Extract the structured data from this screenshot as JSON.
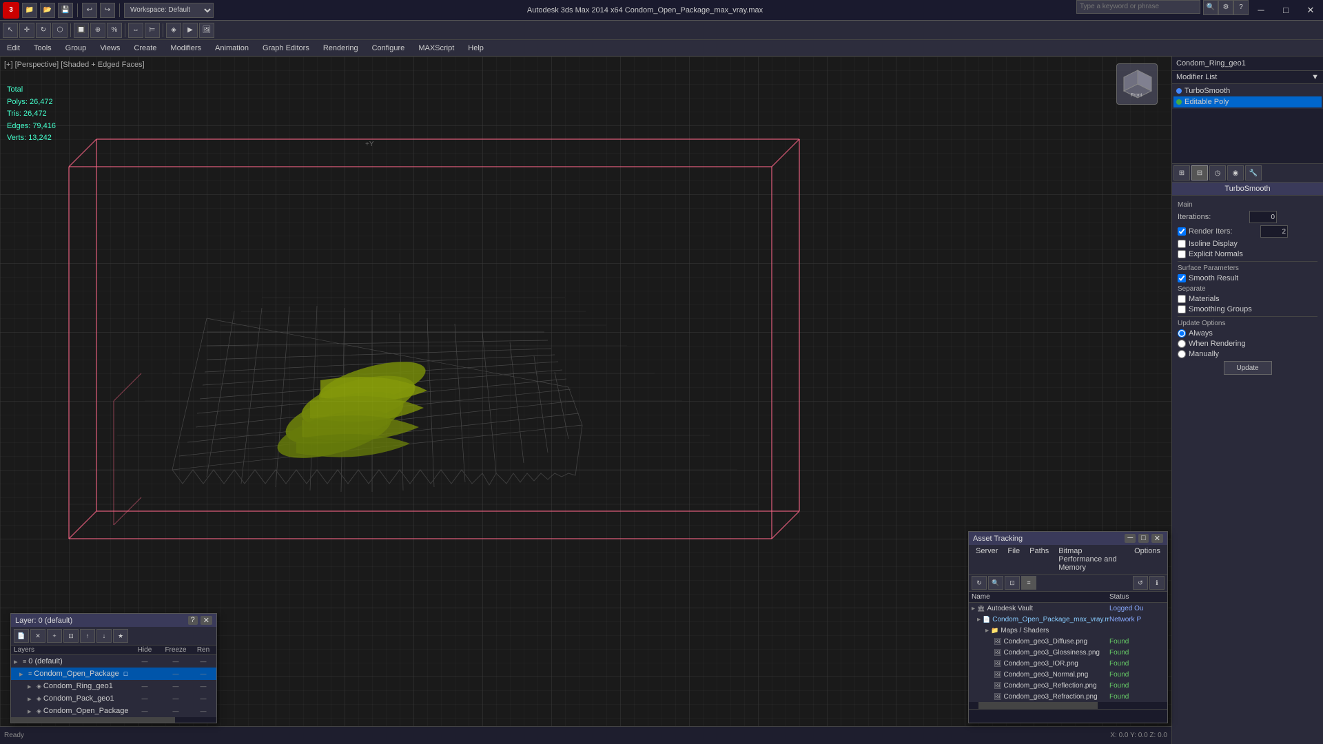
{
  "titlebar": {
    "title": "Autodesk 3ds Max 2014 x64    Condom_Open_Package_max_vray.max",
    "logo": "3",
    "minimize": "─",
    "maximize": "□",
    "close": "✕",
    "search_placeholder": "Type a keyword or phrase"
  },
  "toolbar": {
    "workspace_label": "Workspace: Default",
    "buttons": [
      "📁",
      "💾",
      "↩",
      "↪",
      "▶"
    ],
    "icons": [
      "⚙",
      "⚙",
      "⚙",
      "⚙",
      "⚙",
      "⚙",
      "⚙",
      "⚙",
      "?"
    ]
  },
  "menubar": {
    "items": [
      "Edit",
      "Tools",
      "Group",
      "Views",
      "Create",
      "Modifiers",
      "Animation",
      "Graph Editors",
      "Rendering",
      "Configure",
      "MAXScript",
      "Help"
    ]
  },
  "viewport": {
    "label": "[+] [Perspective] [Shaded + Edged Faces]",
    "stats": {
      "polys_label": "Polys:",
      "polys_val": "26,472",
      "tris_label": "Tris:",
      "tris_val": "26,472",
      "edges_label": "Edges:",
      "edges_val": "79,416",
      "verts_label": "Verts:",
      "verts_val": "13,242",
      "total_label": "Total"
    }
  },
  "right_panel": {
    "object_name": "Condom_Ring_geo1",
    "modifier_list_label": "Modifier List",
    "modifiers": [
      {
        "name": "TurboSmooth",
        "type": "blue"
      },
      {
        "name": "Editable Poly",
        "type": "green"
      }
    ],
    "turbosmooth": {
      "header": "TurboSmooth",
      "main_label": "Main",
      "iterations_label": "Iterations:",
      "iterations_val": "0",
      "render_iters_label": "Render Iters:",
      "render_iters_val": "2",
      "isoline_label": "Isoline Display",
      "explicit_normals_label": "Explicit Normals",
      "surface_params_label": "Surface Parameters",
      "smooth_result_label": "Smooth Result",
      "separate_label": "Separate",
      "materials_label": "Materials",
      "smoothing_groups_label": "Smoothing Groups",
      "update_options_label": "Update Options",
      "always_label": "Always",
      "when_rendering_label": "When Rendering",
      "manually_label": "Manually",
      "update_btn": "Update"
    }
  },
  "layer_panel": {
    "title": "Layer: 0 (default)",
    "help_btn": "?",
    "close_btn": "✕",
    "columns": {
      "name": "Layers",
      "hide": "Hide",
      "freeze": "Freeze",
      "ren": "Ren"
    },
    "layers": [
      {
        "indent": 0,
        "icon": "▸",
        "name": "0 (default)",
        "hide": "—",
        "freeze": "—",
        "ren": "—",
        "selected": false
      },
      {
        "indent": 1,
        "icon": "▸",
        "name": "Condom_Open_Package",
        "hide": "",
        "freeze": "—",
        "ren": "—",
        "selected": true
      },
      {
        "indent": 2,
        "icon": "▸",
        "name": "Condom_Ring_geo1",
        "hide": "—",
        "freeze": "—",
        "ren": "—",
        "selected": false
      },
      {
        "indent": 2,
        "icon": "▸",
        "name": "Condom_Pack_geo1",
        "hide": "—",
        "freeze": "—",
        "ren": "—",
        "selected": false
      },
      {
        "indent": 2,
        "icon": "▸",
        "name": "Condom_Open_Package",
        "hide": "—",
        "freeze": "—",
        "ren": "—",
        "selected": false
      }
    ]
  },
  "asset_panel": {
    "title": "Asset Tracking",
    "minimize_btn": "─",
    "restore_btn": "□",
    "close_btn": "✕",
    "menus": [
      "Server",
      "File",
      "Paths",
      "Bitmap Performance and Memory",
      "Options"
    ],
    "columns": {
      "name": "Name",
      "status": "Status"
    },
    "assets": [
      {
        "indent": 0,
        "icon": "🏛",
        "name": "Autodesk Vault",
        "status": "Logged Ou",
        "type": "vault"
      },
      {
        "indent": 1,
        "icon": "📄",
        "name": "Condom_Open_Package_max_vray.max",
        "status": "Network P",
        "type": "file"
      },
      {
        "indent": 2,
        "icon": "📁",
        "name": "Maps / Shaders",
        "status": "",
        "type": "folder"
      },
      {
        "indent": 3,
        "icon": "🖼",
        "name": "Condom_geo3_Diffuse.png",
        "status": "Found",
        "type": "image"
      },
      {
        "indent": 3,
        "icon": "🖼",
        "name": "Condom_geo3_Glossiness.png",
        "status": "Found",
        "type": "image"
      },
      {
        "indent": 3,
        "icon": "🖼",
        "name": "Condom_geo3_IOR.png",
        "status": "Found",
        "type": "image"
      },
      {
        "indent": 3,
        "icon": "🖼",
        "name": "Condom_geo3_Normal.png",
        "status": "Found",
        "type": "image"
      },
      {
        "indent": 3,
        "icon": "🖼",
        "name": "Condom_geo3_Reflection.png",
        "status": "Found",
        "type": "image"
      },
      {
        "indent": 3,
        "icon": "🖼",
        "name": "Condom_geo3_Refraction.png",
        "status": "Found",
        "type": "image"
      }
    ]
  },
  "colors": {
    "accent_blue": "#0066cc",
    "accent_green": "#44aa44",
    "bg_dark": "#1e1e2e",
    "bg_mid": "#2a2a3a",
    "bg_panel": "#3a3a5a",
    "highlight_yellow": "#cccc00",
    "grid_color": "#444444",
    "pink_border": "#ff6688"
  }
}
